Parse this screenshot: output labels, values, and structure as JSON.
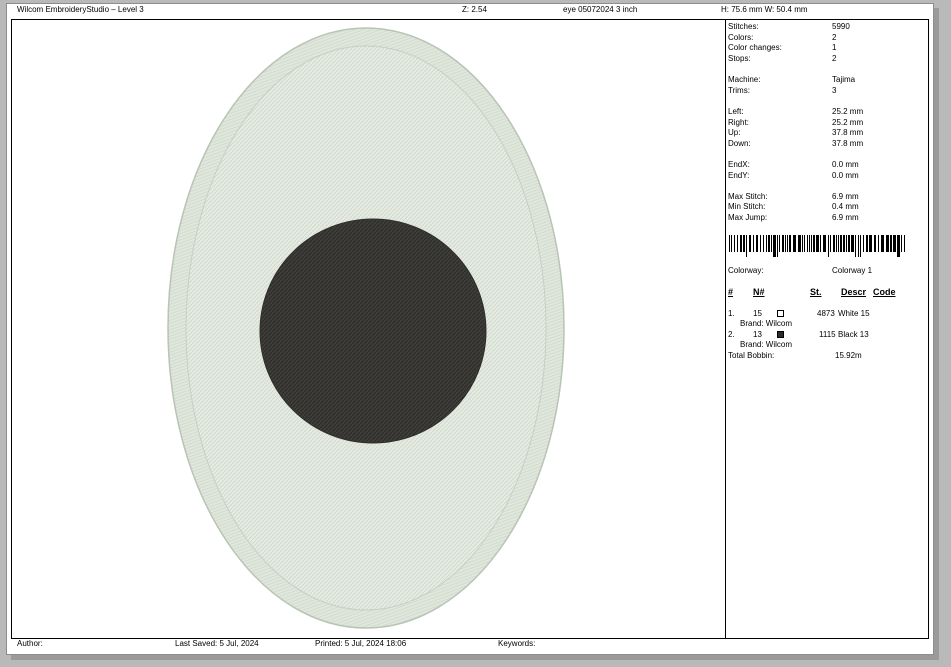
{
  "header": {
    "title": "Wilcom EmbroideryStudio – Level 3",
    "zoom": "Z: 2.54",
    "filename": "eye 05072024 3 inch",
    "size": "H: 75.6 mm   W: 50.4 mm"
  },
  "stats": [
    {
      "label": "Stitches:",
      "value": "5990"
    },
    {
      "label": "Colors:",
      "value": "2"
    },
    {
      "label": "Color changes:",
      "value": "1"
    },
    {
      "label": "Stops:",
      "value": "2"
    },
    {
      "label": "Machine:",
      "value": "Tajima"
    },
    {
      "label": "Trims:",
      "value": "3"
    },
    {
      "label": "Left:",
      "value": "25.2 mm"
    },
    {
      "label": "Right:",
      "value": "25.2 mm"
    },
    {
      "label": "Up:",
      "value": "37.8 mm"
    },
    {
      "label": "Down:",
      "value": "37.8 mm"
    },
    {
      "label": "EndX:",
      "value": "0.0 mm"
    },
    {
      "label": "EndY:",
      "value": "0.0 mm"
    },
    {
      "label": "Max Stitch:",
      "value": "6.9 mm"
    },
    {
      "label": "Min Stitch:",
      "value": "0.4 mm"
    },
    {
      "label": "Max Jump:",
      "value": "6.9 mm"
    }
  ],
  "colorway": {
    "label": "Colorway:",
    "value": "Colorway 1"
  },
  "table": {
    "headers": {
      "num": "#",
      "n": "N#",
      "st": "St.",
      "descr": "Descr",
      "code": "Code"
    },
    "rows": [
      {
        "num": "1.",
        "n": "15",
        "st": "4873",
        "descr": "White 15",
        "brand": "Brand: Wilcom",
        "color": "#ffffff"
      },
      {
        "num": "2.",
        "n": "13",
        "st": "1115",
        "descr": "Black 13",
        "brand": "Brand: Wilcom",
        "color": "#2a2a2a"
      }
    ],
    "bobbin": {
      "label": "Total Bobbin:",
      "value": "15.92m"
    }
  },
  "footer": {
    "author": "Author:",
    "last_saved": "Last Saved:  5 Jul, 2024",
    "printed": "Printed:  5 Jul, 2024 18:06",
    "keywords": "Keywords:"
  },
  "colors": {
    "thread_light": "#e3e9df",
    "thread_border": "#c9d4c6",
    "thread_dark": "#3b3a36"
  }
}
